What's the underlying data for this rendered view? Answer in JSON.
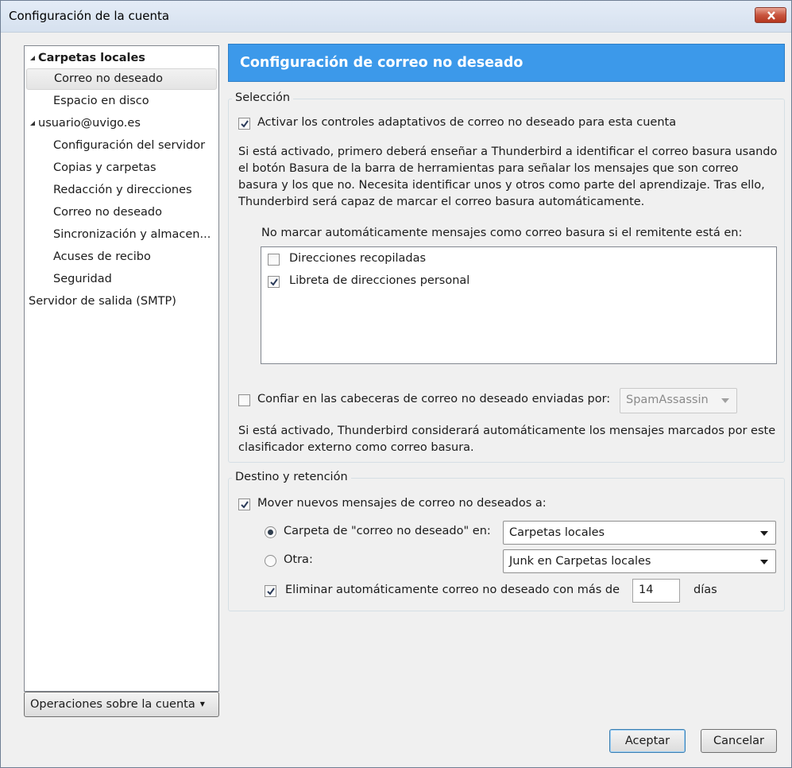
{
  "window": {
    "title": "Configuración de la cuenta"
  },
  "tree": {
    "items": [
      {
        "label": "Carpetas locales"
      },
      {
        "label": "Correo no deseado"
      },
      {
        "label": "Espacio en disco"
      },
      {
        "label": "usuario@uvigo.es"
      },
      {
        "label": "Configuración del servidor"
      },
      {
        "label": "Copias y carpetas"
      },
      {
        "label": "Redacción y direcciones"
      },
      {
        "label": "Correo no deseado"
      },
      {
        "label": "Sincronización y almacen..."
      },
      {
        "label": "Acuses de recibo"
      },
      {
        "label": "Seguridad"
      },
      {
        "label": "Servidor de salida (SMTP)"
      }
    ],
    "ops_button": "Operaciones sobre la cuenta"
  },
  "header": {
    "title": "Configuración de correo no deseado"
  },
  "seleccion": {
    "legend": "Selección",
    "adaptive_checkbox_label": "Activar los controles adaptativos de correo no deseado para esta cuenta",
    "adaptive_checked": true,
    "description": "Si está activado, primero deberá enseñar a Thunderbird a identificar el correo basura usando el botón Basura de la barra de herramientas para señalar los mensajes que son correo basura y los que no. Necesita identificar unos y otros como parte del aprendizaje. Tras ello, Thunderbird será capaz de marcar el correo basura automáticamente.",
    "whitelist_label": "No marcar automáticamente mensajes como correo basura si el remitente está en:",
    "whitelist": [
      {
        "label": "Direcciones recopiladas",
        "checked": false
      },
      {
        "label": "Libreta de direcciones personal",
        "checked": true
      }
    ],
    "trust_headers_label": "Confiar en las cabeceras de correo no deseado enviadas por:",
    "trust_headers_checked": false,
    "trust_headers_select": "SpamAssassin",
    "trust_description": "Si está activado, Thunderbird considerará automáticamente los mensajes marcados por este clasificador externo como correo basura."
  },
  "destino": {
    "legend": "Destino y retención",
    "move_label": "Mover nuevos mensajes de correo no deseados a:",
    "move_checked": true,
    "radio_folder_label": "Carpeta de \"correo no deseado\" en:",
    "radio_folder_selected": true,
    "folder_select": "Carpetas locales",
    "radio_other_label": "Otra:",
    "other_select": "Junk en Carpetas locales",
    "delete_label": "Eliminar automáticamente correo no deseado con más de",
    "delete_checked": true,
    "delete_days": "14",
    "days_label": "días"
  },
  "buttons": {
    "accept": "Aceptar",
    "cancel": "Cancelar"
  }
}
